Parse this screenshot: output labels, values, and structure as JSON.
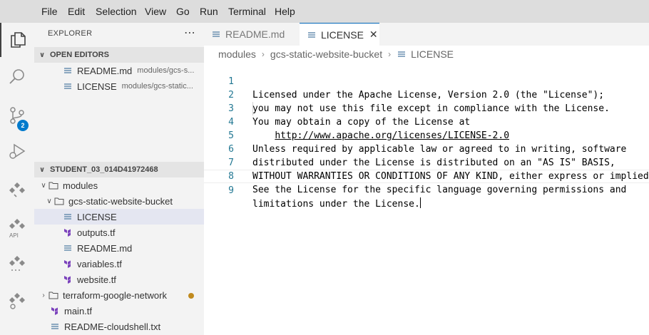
{
  "menu": [
    "File",
    "Edit",
    "Selection",
    "View",
    "Go",
    "Run",
    "Terminal",
    "Help"
  ],
  "activity": {
    "source_control_badge": "2",
    "api_label": "API"
  },
  "sidebar": {
    "title": "EXPLORER",
    "more": "⋯",
    "open_editors": {
      "header": "OPEN EDITORS",
      "items": [
        {
          "name": "README.md",
          "desc": "modules/gcs-s..."
        },
        {
          "name": "LICENSE",
          "desc": "modules/gcs-static..."
        }
      ]
    },
    "workspace": {
      "header": "STUDENT_03_014D41972468",
      "items": [
        {
          "label": "modules"
        },
        {
          "label": "gcs-static-website-bucket"
        },
        {
          "label": "LICENSE"
        },
        {
          "label": "outputs.tf"
        },
        {
          "label": "README.md"
        },
        {
          "label": "variables.tf"
        },
        {
          "label": "website.tf"
        },
        {
          "label": "terraform-google-network"
        },
        {
          "label": "main.tf"
        },
        {
          "label": "README-cloudshell.txt"
        }
      ]
    }
  },
  "tabs": [
    {
      "label": "README.md"
    },
    {
      "label": "LICENSE",
      "close": "✕"
    }
  ],
  "breadcrumb": [
    "modules",
    "gcs-static-website-bucket",
    "LICENSE"
  ],
  "breadcrumb_sep": "›",
  "editor": {
    "lines": [
      {
        "n": "1",
        "text": "Licensed under the Apache License, Version 2.0 (the \"License\");"
      },
      {
        "n": "2",
        "text": "you may not use this file except in compliance with the License."
      },
      {
        "n": "3",
        "text": "You may obtain a copy of the License at"
      },
      {
        "n": "4",
        "prefix": "    ",
        "link": "http://www.apache.org/licenses/LICENSE-2.0"
      },
      {
        "n": "5",
        "text": "Unless required by applicable law or agreed to in writing, software"
      },
      {
        "n": "6",
        "text": "distributed under the License is distributed on an \"AS IS\" BASIS,"
      },
      {
        "n": "7",
        "text": "WITHOUT WARRANTIES OR CONDITIONS OF ANY KIND, either express or implied."
      },
      {
        "n": "8",
        "text": "See the License for the specific language governing permissions and"
      },
      {
        "n": "9",
        "text": "limitations under the License."
      }
    ]
  },
  "colors": {
    "accent": "#007acc",
    "modified_dot": "#c08a1e",
    "terraform": "#7b42bc"
  }
}
